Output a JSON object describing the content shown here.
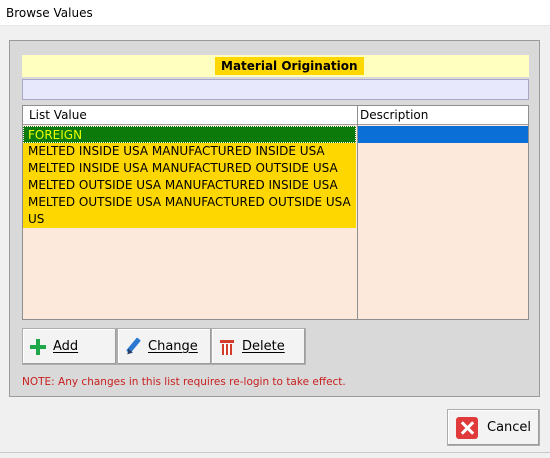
{
  "window": {
    "title": "Browse Values"
  },
  "header": {
    "label": "Material Origination"
  },
  "filter": {
    "value": "",
    "placeholder": ""
  },
  "grid": {
    "columns": [
      "List Value",
      "Description"
    ],
    "rows": [
      {
        "value": "FOREIGN",
        "description": "",
        "selected": true
      },
      {
        "value": "MELTED INSIDE USA MANUFACTURED INSIDE USA",
        "description": ""
      },
      {
        "value": "MELTED INSIDE USA MANUFACTURED OUTSIDE USA",
        "description": ""
      },
      {
        "value": "MELTED OUTSIDE USA MANUFACTURED INSIDE USA",
        "description": ""
      },
      {
        "value": "MELTED OUTSIDE USA MANUFACTURED OUTSIDE USA",
        "description": ""
      },
      {
        "value": "US",
        "description": ""
      }
    ]
  },
  "buttons": {
    "add": "Add",
    "change": "Change",
    "delete": "Delete",
    "cancel": "Cancel"
  },
  "note": "NOTE: Any changes in this list requires re-login to take effect.",
  "colors": {
    "header_band": "#ffffc0",
    "header_label": "#ffd700",
    "row_highlight": "#ffd700",
    "selected_row": "#0b7a0b",
    "selected_text": "#e8ff00",
    "description_selected": "#0a6fd6",
    "grid_bg": "#fde9dc",
    "note_text": "#c81e1e"
  },
  "icons": {
    "add": "plus-icon",
    "change": "pencil-icon",
    "delete": "trash-icon",
    "cancel": "cancel-icon"
  }
}
